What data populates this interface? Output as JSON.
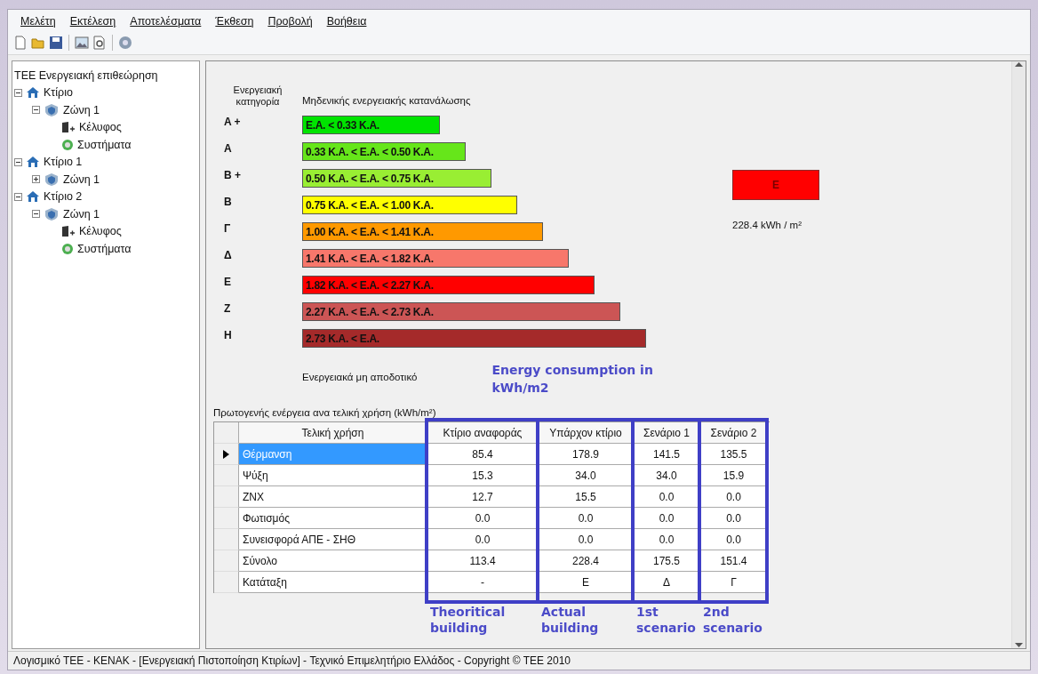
{
  "menu": [
    {
      "label": "Μελέτη"
    },
    {
      "label": "Εκτέλεση"
    },
    {
      "label": "Αποτελέσματα"
    },
    {
      "label": "Έκθεση"
    },
    {
      "label": "Προβολή"
    },
    {
      "label": "Βοήθεια"
    }
  ],
  "tree": {
    "root": "ΤΕΕ Ενεργειακή επιθεώρηση",
    "children": [
      {
        "kind": "building",
        "label": "Κτίριο",
        "expanded": true,
        "children": [
          {
            "kind": "zone",
            "label": "Ζώνη 1",
            "expanded": true,
            "children": [
              {
                "kind": "shell",
                "label": "Κέλυφος"
              },
              {
                "kind": "systems",
                "label": "Συστήματα"
              }
            ]
          }
        ]
      },
      {
        "kind": "building",
        "label": "Κτίριο 1",
        "expanded": true,
        "children": [
          {
            "kind": "zone",
            "label": "Ζώνη 1",
            "expanded": false
          }
        ]
      },
      {
        "kind": "building",
        "label": "Κτίριο 2",
        "expanded": true,
        "children": [
          {
            "kind": "zone",
            "label": "Ζώνη 1",
            "expanded": true,
            "children": [
              {
                "kind": "shell",
                "label": "Κέλυφος"
              },
              {
                "kind": "systems",
                "label": "Συστήματα"
              }
            ]
          }
        ]
      }
    ]
  },
  "scale": {
    "category_label": "Ενεργειακή κατηγορία",
    "top_label": "Μηδενικής ενεργειακής κατανάλωσης",
    "bottom_label": "Ενεργειακά μη αποδοτικό",
    "classes": [
      {
        "label": "A +",
        "range": "E.A. < 0.33 K.A.",
        "color": "#00e400"
      },
      {
        "label": "A",
        "range": "0.33 K.A. <  E.A. < 0.50 K.A.",
        "color": "#66e61a"
      },
      {
        "label": "B +",
        "range": "0.50 K.A. <  E.A. < 0.75 K.A.",
        "color": "#99ee33"
      },
      {
        "label": "B",
        "range": "0.75 K.A. <  E.A. < 1.00 K.A.",
        "color": "#ffff00"
      },
      {
        "label": "Γ",
        "range": "1.00 K.A. <  E.A. < 1.41 K.A.",
        "color": "#ff9900"
      },
      {
        "label": "Δ",
        "range": "1.41 K.A. <  E.A. < 1.82 K.A.",
        "color": "#f7776b"
      },
      {
        "label": "E",
        "range": "1.82 K.A. <  E.A. < 2.27 K.A.",
        "color": "#ff0000"
      },
      {
        "label": "Z",
        "range": "2.27 K.A. <  E.A. < 2.73 K.A.",
        "color": "#cc5555"
      },
      {
        "label": "H",
        "range": "2.73 K.A. <  E.A.",
        "color": "#a52a2a"
      }
    ]
  },
  "rating": {
    "label": "E",
    "color": "#ff0000",
    "reading": "228.4 kWh / m²"
  },
  "table": {
    "title": "Πρωτογενής ενέργεια ανα τελική χρήση (kWh/m²)",
    "columns": [
      {
        "label": "Τελική χρήση",
        "annotated": false
      },
      {
        "label": "Κτίριο αναφοράς",
        "annotated": true
      },
      {
        "label": "Υπάρχον κτίριο",
        "annotated": true
      },
      {
        "label": "Σενάριο 1",
        "annotated": true
      },
      {
        "label": "Σενάριο 2",
        "annotated": true
      }
    ],
    "rows": [
      {
        "selected": true,
        "cells": [
          "Θέρμανση",
          "85.4",
          "178.9",
          "141.5",
          "135.5"
        ]
      },
      {
        "selected": false,
        "cells": [
          "Ψύξη",
          "15.3",
          "34.0",
          "34.0",
          "15.9"
        ]
      },
      {
        "selected": false,
        "cells": [
          "ZNX",
          "12.7",
          "15.5",
          "0.0",
          "0.0"
        ]
      },
      {
        "selected": false,
        "cells": [
          "Φωτισμός",
          "0.0",
          "0.0",
          "0.0",
          "0.0"
        ]
      },
      {
        "selected": false,
        "cells": [
          "Συνεισφορά ΑΠΕ - ΣΗΘ",
          "0.0",
          "0.0",
          "0.0",
          "0.0"
        ]
      },
      {
        "selected": false,
        "cells": [
          "Σύνολο",
          "113.4",
          "228.4",
          "175.5",
          "151.4"
        ]
      },
      {
        "selected": false,
        "cells": [
          "Κατάταξη",
          "-",
          "E",
          "Δ",
          "Γ"
        ]
      }
    ]
  },
  "annotations": {
    "chart_note": "Energy consumption in kWh/m2",
    "column_notes": [
      "Theoritical building",
      "Actual building",
      "1st scenario",
      "2nd scenario"
    ]
  },
  "status_bar": "Λογισμικό ΤΕΕ - KENAK - [Ενεργειακή Πιστοποίηση Κτιρίων] - Τεχνικό Επιμελητήριο Ελλάδος - Copyright © TEE 2010"
}
